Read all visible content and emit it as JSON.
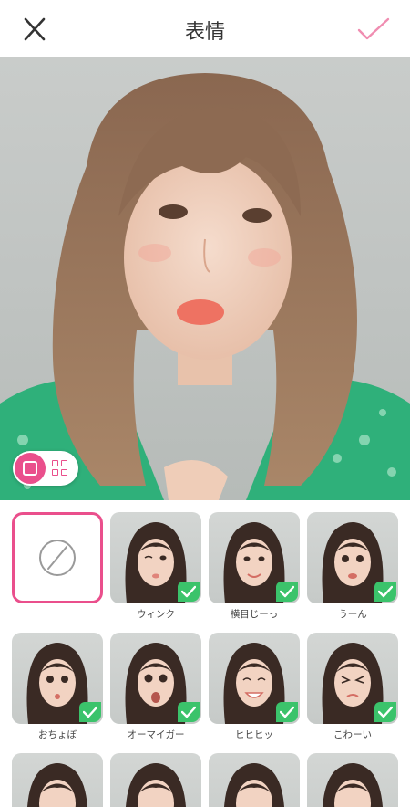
{
  "header": {
    "title": "表情",
    "close_icon": "close-icon",
    "confirm_icon": "check-icon"
  },
  "colors": {
    "accent": "#ea4f8c",
    "check_badge": "#3bc36b"
  },
  "view_toggle": {
    "selected": "single",
    "options": [
      "single-view-icon",
      "grid-view-icon"
    ]
  },
  "expressions": {
    "none_option": {
      "icon": "no-effect-icon",
      "selected": true
    },
    "items": [
      {
        "label": "ウィンク",
        "downloaded": true
      },
      {
        "label": "横目じーっ",
        "downloaded": true
      },
      {
        "label": "うーん",
        "downloaded": true
      },
      {
        "label": "おちょぼ",
        "downloaded": true
      },
      {
        "label": "オーマイガー",
        "downloaded": true
      },
      {
        "label": "ヒヒヒッ",
        "downloaded": true
      },
      {
        "label": "こわーい",
        "downloaded": true
      }
    ]
  }
}
